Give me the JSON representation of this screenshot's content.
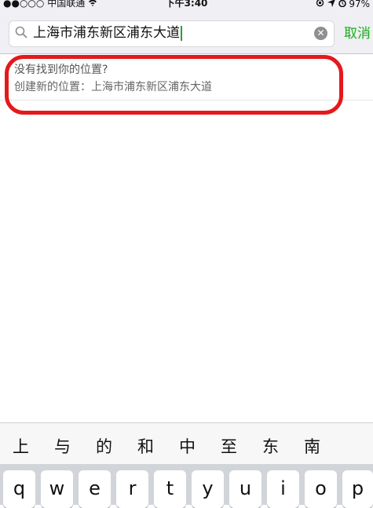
{
  "status": {
    "signal": "●●○○○",
    "carrier": "中国联通",
    "time": "下午3:40",
    "battery": "97%"
  },
  "search": {
    "value": "上海市浦东新区浦东大道",
    "cancel_label": "取消"
  },
  "result": {
    "line1": "没有找到你的位置?",
    "line2": "创建新的位置：上海市浦东新区浦东大道"
  },
  "suggestions": [
    "上",
    "与",
    "的",
    "和",
    "中",
    "至",
    "东",
    "南"
  ],
  "keyboard_row": [
    "q",
    "w",
    "e",
    "r",
    "t",
    "y",
    "u",
    "i",
    "o",
    "p"
  ],
  "colors": {
    "accent_green": "#1aad19",
    "highlight_red": "#e4191b"
  }
}
